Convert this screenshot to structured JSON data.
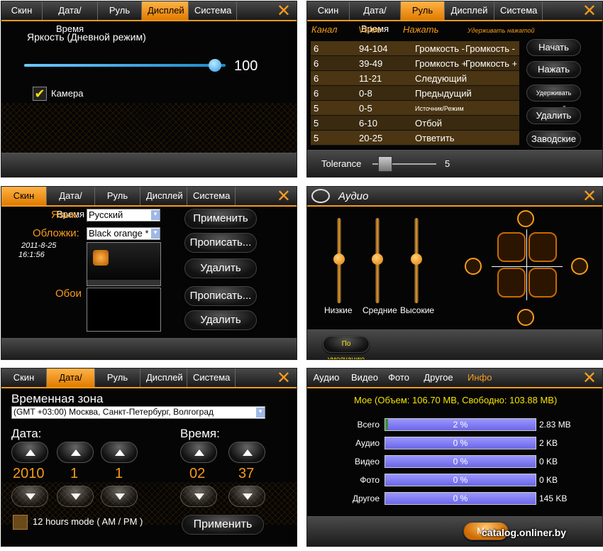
{
  "display": {
    "tabs": [
      "Скин",
      "Дата/Время",
      "Руль",
      "Дисплей",
      "Система"
    ],
    "brightness_label": "Яркость (Дневной режим)",
    "brightness_value": "100",
    "brightness_level": 100,
    "camera_label": "Камера"
  },
  "wheel": {
    "tabs": [
      "Скин",
      "Дата/Время",
      "Руль",
      "Дисплей",
      "Система"
    ],
    "headers": [
      "Канал",
      "Value",
      "Нажать",
      "Удерживать нажатой"
    ],
    "rows": [
      [
        "6",
        "94-104",
        "Громкость -",
        "Громкость -"
      ],
      [
        "6",
        "39-49",
        "Громкость +",
        "Громкость +"
      ],
      [
        "6",
        "11-21",
        "Следующий",
        ""
      ],
      [
        "6",
        "0-8",
        "Предыдущий",
        ""
      ],
      [
        "5",
        "0-5",
        "Источник/Режим",
        ""
      ],
      [
        "5",
        "6-10",
        "Отбой",
        ""
      ],
      [
        "5",
        "20-25",
        "Ответить",
        ""
      ]
    ],
    "buttons": [
      "Начать",
      "Нажать",
      "Удерживать нажатой",
      "Удалить",
      "Заводские"
    ],
    "tolerance_label": "Tolerance",
    "tolerance_value": "5"
  },
  "skin": {
    "tabs": [
      "Скин",
      "Дата/Время",
      "Руль",
      "Дисплей",
      "Система"
    ],
    "lang_label": "Язык:",
    "lang_value": "Русский",
    "skins_label": "Обложки:",
    "skins_value": "Black orange *",
    "date": "2011-8-25",
    "time": "16:1:56",
    "wallpaper_label": "Обои",
    "buttons": [
      "Применить",
      "Прописать...",
      "Удалить",
      "Прописать...",
      "Удалить"
    ]
  },
  "audio": {
    "title": "Аудио",
    "sliders": [
      {
        "label": "Низкие",
        "level": 0.5
      },
      {
        "label": "Средние",
        "level": 0.5
      },
      {
        "label": "Высокие",
        "level": 0.5
      }
    ],
    "default_button": "По умолчанию"
  },
  "datetime": {
    "tabs": [
      "Скин",
      "Дата/Время",
      "Руль",
      "Дисплей",
      "Система"
    ],
    "tz_label": "Временная зона",
    "tz_value": "(GMT +03:00) Москва, Санкт-Петербург, Волгоград",
    "date_label": "Дата:",
    "time_label": "Время:",
    "year": "2010",
    "month": "1",
    "day": "1",
    "hour": "02",
    "minute": "37",
    "hours_mode_label": "12 hours mode ( AM / PM )",
    "apply_button": "Применить"
  },
  "info": {
    "tabs": [
      "Аудио",
      "Видео",
      "Фото",
      "Другое",
      "Инфо"
    ],
    "summary": "Мое (Объем: 106.70 MB, Свободно: 103.88 MB)",
    "rows": [
      {
        "label": "Всего",
        "pct": "2 %",
        "size": "2.83 MB",
        "fill": 2
      },
      {
        "label": "Аудио",
        "pct": "0 %",
        "size": "2 KB",
        "fill": 0
      },
      {
        "label": "Видео",
        "pct": "0 %",
        "size": "0 KB",
        "fill": 0
      },
      {
        "label": "Фото",
        "pct": "0 %",
        "size": "0 KB",
        "fill": 0
      },
      {
        "label": "Другое",
        "pct": "0 %",
        "size": "145 KB",
        "fill": 0
      }
    ],
    "bottom_button": "Мое"
  },
  "watermark": "catalog.onliner.by",
  "colors": {
    "accent": "#f59b1c",
    "bar": "#7d79f0",
    "highlight": "#f5e400"
  }
}
